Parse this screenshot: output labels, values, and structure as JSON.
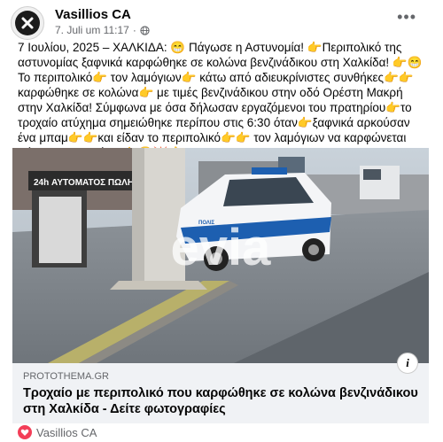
{
  "post": {
    "author": "Vasillios CA",
    "timestamp": "7. Juli um 11:17",
    "separator": "·",
    "text": "7 Ιουλίου, 2025 – ΧΑΛΚΙΔΑ: 😁 Πάγωσε η Αστυνομία! 👉Περιπολικό της αστυνομίας ξαφνικά καρφώθηκε σε κολώνα βενζινάδικου στη Χαλκίδα! 👉😁Το περιπολικό👉 τον λαμόγιων👉 κάτω από αδιευκρίνιστες συνθήκες👉👉καρφώθηκε σε κολώνα👉 με τιμές βενζινάδικου στην οδό Ορέστη Μακρή στην Χαλκίδα! Σύμφωνα με όσα δήλωσαν εργαζόμενοι του πρατηρίου👉το τροχαίο ατύχημα σημειώθηκε περίπου στις 6:30 όταν👉ξαφνικά αρκούσαν ένα μπαμ👉👉και είδαν το περιπολικό👉👉 τον λαμόγιων να καρφώνεται πάνω στην κολώνα!👉😁💥👍"
  },
  "media": {
    "watermark": "evia",
    "sign_text": "24h ΑΥΤΟΜΑΤΟΣ ΠΩΛΗΤΗΣ",
    "car_text": "ΠΟΛΙΣ"
  },
  "link_preview": {
    "domain": "PROTOTHEMA.GR",
    "title": "Τροχαίο με περιπολικό που καρφώθηκε σε κολώνα βενζινάδικου στη Χαλκίδα - Δείτε φωτογραφίες",
    "info": "i"
  },
  "reactions": {
    "names": "Vasillios CA",
    "icon": "heart-reaction-icon"
  },
  "icons": {
    "avatar": "x-logo-icon",
    "privacy": "globe-icon",
    "more": "more-options-icon"
  },
  "colors": {
    "author_text": "#050505",
    "meta_text": "#65676b",
    "link_box_bg": "#f0f2f5",
    "reaction_heart": "#f33e58",
    "police_blue": "#1d5fb0"
  }
}
